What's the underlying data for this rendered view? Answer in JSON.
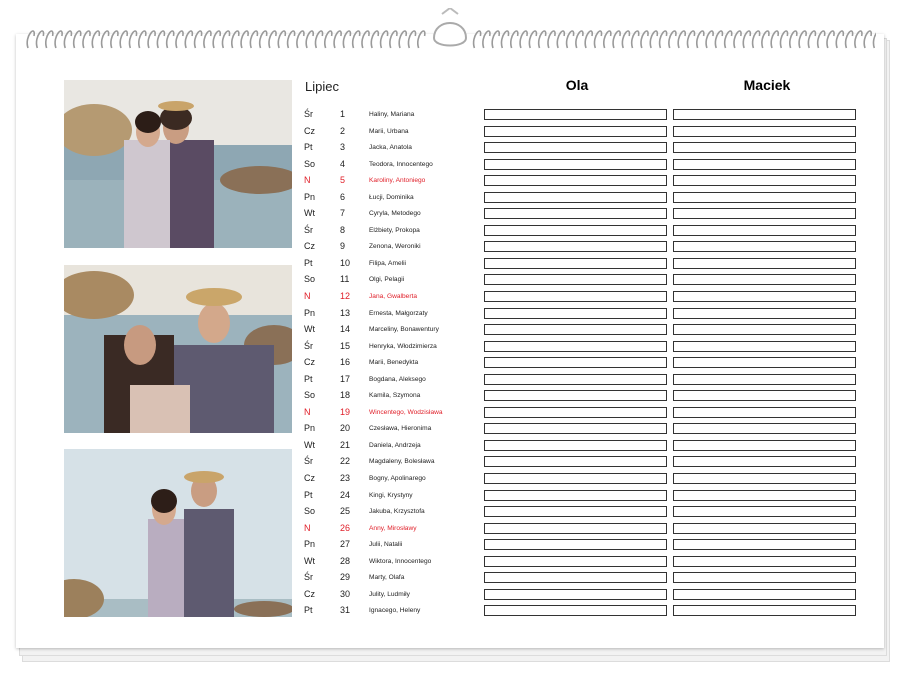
{
  "calendar": {
    "month": "Lipiec",
    "columns": [
      "Ola",
      "Maciek"
    ],
    "colors": {
      "sunday": "#e0202a",
      "text": "#222222"
    },
    "days": [
      {
        "wd": "Śr",
        "d": "1",
        "names": "Haliny, Mariana",
        "sun": false
      },
      {
        "wd": "Cz",
        "d": "2",
        "names": "Marii, Urbana",
        "sun": false
      },
      {
        "wd": "Pt",
        "d": "3",
        "names": "Jacka, Anatola",
        "sun": false
      },
      {
        "wd": "So",
        "d": "4",
        "names": "Teodora, Innocentego",
        "sun": false
      },
      {
        "wd": "N",
        "d": "5",
        "names": "Karoliny, Antoniego",
        "sun": true
      },
      {
        "wd": "Pn",
        "d": "6",
        "names": "Łucji, Dominika",
        "sun": false
      },
      {
        "wd": "Wt",
        "d": "7",
        "names": "Cyryla, Metodego",
        "sun": false
      },
      {
        "wd": "Śr",
        "d": "8",
        "names": "Elżbiety, Prokopa",
        "sun": false
      },
      {
        "wd": "Cz",
        "d": "9",
        "names": "Zenona, Weroniki",
        "sun": false
      },
      {
        "wd": "Pt",
        "d": "10",
        "names": "Filipa, Amelii",
        "sun": false
      },
      {
        "wd": "So",
        "d": "11",
        "names": "Olgi, Pelagii",
        "sun": false
      },
      {
        "wd": "N",
        "d": "12",
        "names": "Jana, Gwalberta",
        "sun": true
      },
      {
        "wd": "Pn",
        "d": "13",
        "names": "Ernesta, Małgorzaty",
        "sun": false
      },
      {
        "wd": "Wt",
        "d": "14",
        "names": "Marceliny, Bonawentury",
        "sun": false
      },
      {
        "wd": "Śr",
        "d": "15",
        "names": "Henryka, Włodzimierza",
        "sun": false
      },
      {
        "wd": "Cz",
        "d": "16",
        "names": "Marii, Benedykta",
        "sun": false
      },
      {
        "wd": "Pt",
        "d": "17",
        "names": "Bogdana, Aleksego",
        "sun": false
      },
      {
        "wd": "So",
        "d": "18",
        "names": "Kamila, Szymona",
        "sun": false
      },
      {
        "wd": "N",
        "d": "19",
        "names": "Wincentego, Wodzisława",
        "sun": true
      },
      {
        "wd": "Pn",
        "d": "20",
        "names": "Czesława, Hieronima",
        "sun": false
      },
      {
        "wd": "Wt",
        "d": "21",
        "names": "Daniela, Andrzeja",
        "sun": false
      },
      {
        "wd": "Śr",
        "d": "22",
        "names": "Magdaleny, Bolesława",
        "sun": false
      },
      {
        "wd": "Cz",
        "d": "23",
        "names": "Bogny, Apolinarego",
        "sun": false
      },
      {
        "wd": "Pt",
        "d": "24",
        "names": "Kingi, Krystyny",
        "sun": false
      },
      {
        "wd": "So",
        "d": "25",
        "names": "Jakuba, Krzysztofa",
        "sun": false
      },
      {
        "wd": "N",
        "d": "26",
        "names": "Anny, Mirosławy",
        "sun": true
      },
      {
        "wd": "Pn",
        "d": "27",
        "names": "Julii, Natalii",
        "sun": false
      },
      {
        "wd": "Wt",
        "d": "28",
        "names": "Wiktora, Innocentego",
        "sun": false
      },
      {
        "wd": "Śr",
        "d": "29",
        "names": "Marty, Olafa",
        "sun": false
      },
      {
        "wd": "Cz",
        "d": "30",
        "names": "Julity, Ludmiły",
        "sun": false
      },
      {
        "wd": "Pt",
        "d": "31",
        "names": "Ignacego, Heleny",
        "sun": false
      }
    ]
  },
  "photos": [
    "couple-photo-1",
    "couple-photo-2",
    "couple-photo-3"
  ]
}
